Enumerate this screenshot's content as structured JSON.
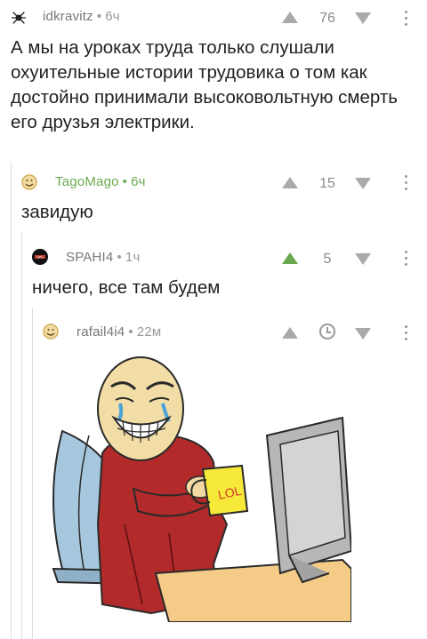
{
  "comments": [
    {
      "author": "idkravitz",
      "time": "6ч",
      "score": "76",
      "text": "А мы на уроках труда только слушали охуительные истории трудовика о том как достойно принимали высоковольтную смерть его друзья электрики.",
      "avatar_icon": "spider-avatar-icon"
    },
    {
      "author": "TagoMago",
      "time": "6ч",
      "score": "15",
      "text": "завидую",
      "author_color": "#6aa84f",
      "avatar_icon": "face-avatar-icon"
    },
    {
      "author": "SPAHI4",
      "time": "1ч",
      "score": "5",
      "text": "ничего, все там будем",
      "upvoted": true,
      "upvote_color": "#6aa84f",
      "avatar_icon": "red-logo-avatar-icon"
    },
    {
      "author": "rafail4i4",
      "time": "22м",
      "score": "",
      "image_caption_text": "LOL",
      "image_description": "meme-laughing-face-with-mug",
      "avatar_icon": "face-avatar-icon"
    }
  ],
  "colors": {
    "accent_green": "#6aa84f",
    "vote_gray": "#aaaaaa",
    "meta_gray": "#999999"
  }
}
